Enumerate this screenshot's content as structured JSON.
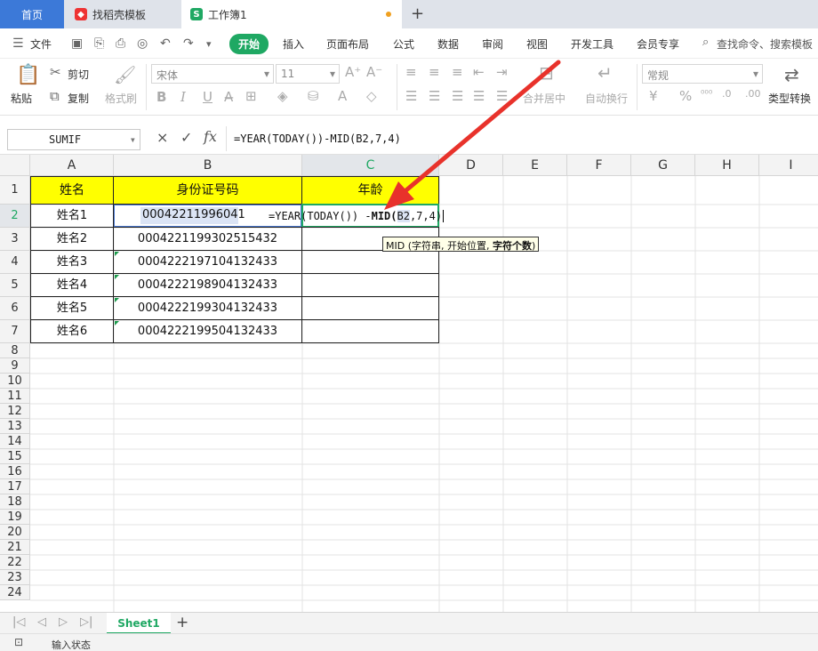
{
  "tabs": {
    "home": "首页",
    "template": "找稻壳模板",
    "workbook": "工作簿1",
    "add": "+"
  },
  "menu": {
    "file": "文件",
    "items": [
      "开始",
      "插入",
      "页面布局",
      "公式",
      "数据",
      "审阅",
      "视图",
      "开发工具",
      "会员专享"
    ],
    "search": "查找命令、搜索模板"
  },
  "ribbon": {
    "paste": "粘贴",
    "cut": "剪切",
    "copy": "复制",
    "format_painter": "格式刷",
    "font": "宋体",
    "size": "11",
    "merge": "合并居中",
    "wrap": "自动换行",
    "number_format": "常规",
    "convert": "类型转换",
    "bold": "B",
    "italic": "I",
    "underline": "U",
    "currency": "¥",
    "percent": "%"
  },
  "formula_bar": {
    "name_box": "SUMIF",
    "cancel": "×",
    "confirm": "✓",
    "fx": "fx",
    "formula": "=YEAR(TODAY())-MID(B2,7,4)"
  },
  "columns": [
    "A",
    "B",
    "C",
    "D",
    "E",
    "F",
    "G",
    "H",
    "I"
  ],
  "rows": [
    "1",
    "2",
    "3",
    "4",
    "5",
    "6",
    "7",
    "8",
    "9",
    "10",
    "11",
    "12",
    "13",
    "14",
    "15",
    "16",
    "17",
    "18",
    "19",
    "20",
    "21",
    "22",
    "23",
    "24"
  ],
  "table": {
    "headers": [
      "姓名",
      "身份证号码",
      "年龄"
    ],
    "rows": [
      {
        "name": "姓名1",
        "id": "00042211996041",
        "age": ""
      },
      {
        "name": "姓名2",
        "id": "0004221199302515432",
        "age": ""
      },
      {
        "name": "姓名3",
        "id": "0004222197104132433",
        "age": ""
      },
      {
        "name": "姓名4",
        "id": "0004222198904132433",
        "age": ""
      },
      {
        "name": "姓名5",
        "id": "0004222199304132433",
        "age": ""
      },
      {
        "name": "姓名6",
        "id": "0004222199504132433",
        "age": ""
      }
    ]
  },
  "edit_cell": {
    "part1": "=YEAR(TODAY()) -",
    "part2": "MID(",
    "ref": "B2",
    "part3": ",7,4)"
  },
  "tooltip": {
    "text": "MID (字符串, 开始位置, ",
    "bold": "字符个数",
    "end": ")"
  },
  "sheet": {
    "name": "Sheet1",
    "add": "+"
  },
  "status": {
    "text": "输入状态"
  },
  "colors": {
    "accent": "#1fa863",
    "header_fill": "#ffff00",
    "arrow": "#e8322b",
    "tab_active": "#3c79d8"
  }
}
